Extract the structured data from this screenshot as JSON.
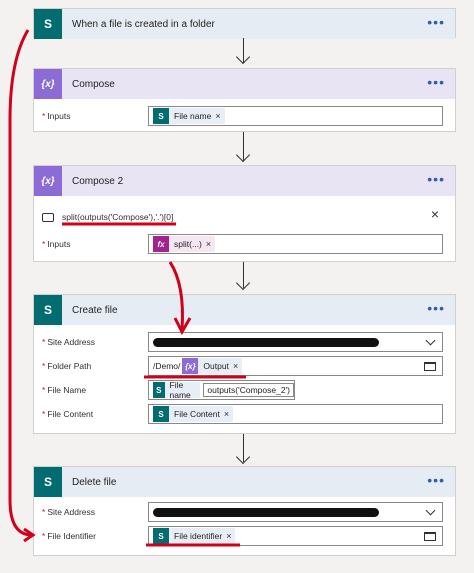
{
  "cards": {
    "trigger": {
      "title": "When a file is created in a folder",
      "more": "•••"
    },
    "compose": {
      "title": "Compose",
      "more": "•••",
      "inputs_label": "Inputs",
      "token": "File name"
    },
    "compose2": {
      "title": "Compose 2",
      "more": "•••",
      "expression": "split(outputs('Compose'),'.')[0]",
      "inputs_label": "Inputs",
      "token": "split(...)"
    },
    "create_file": {
      "title": "Create file",
      "more": "•••",
      "site_label": "Site Address",
      "folder_label": "Folder Path",
      "folder_prefix": "/Demo/",
      "folder_token": "Output",
      "name_label": "File Name",
      "name_token": "File name",
      "name_text": "outputs('Compose_2')",
      "content_label": "File Content",
      "content_token": "File Content"
    },
    "delete_file": {
      "title": "Delete file",
      "more": "•••",
      "site_label": "Site Address",
      "identifier_label": "File Identifier",
      "identifier_token": "File identifier"
    }
  },
  "glyphs": {
    "sp": "S",
    "compose": "{x}",
    "fx": "fx",
    "close": "×",
    "required": "*"
  },
  "colors": {
    "sharepoint": "#036c70",
    "compose": "#8c6cd4",
    "expression": "#a3238e",
    "annotation": "#d0021b"
  }
}
